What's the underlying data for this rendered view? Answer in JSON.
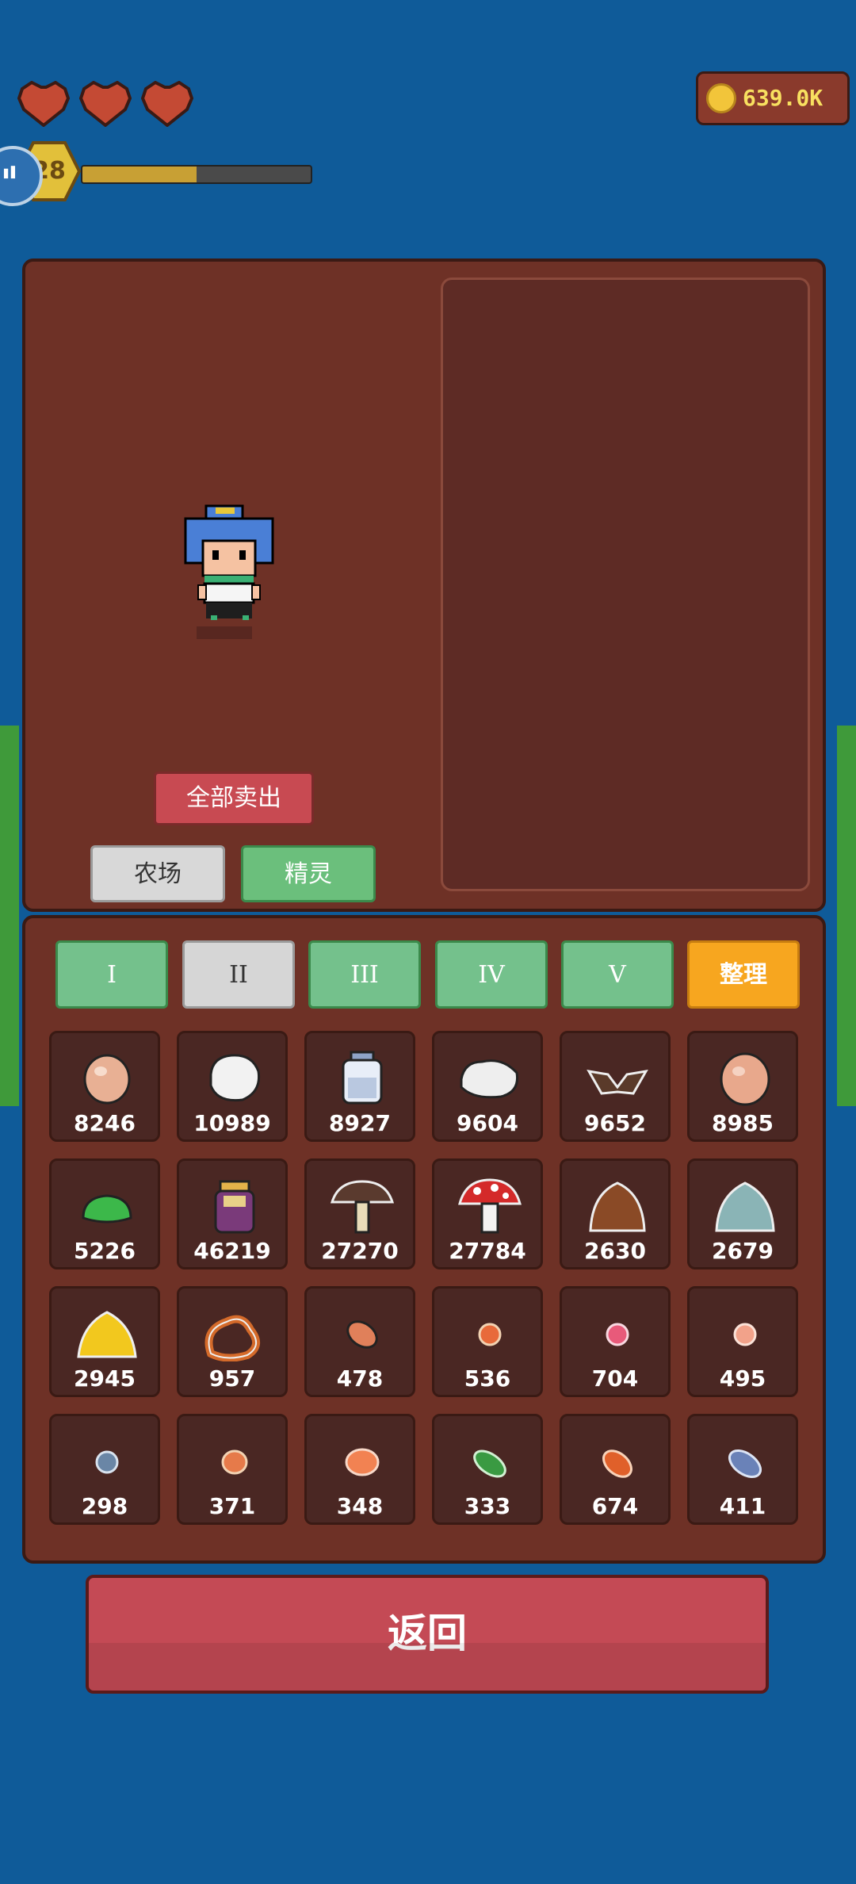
{
  "hud": {
    "hearts": 3,
    "level": "28",
    "level_progress": 0.5,
    "coins": "639.0K"
  },
  "buttons": {
    "sell_all": "全部卖出",
    "farm_tab": "农场",
    "elf_tab": "精灵",
    "back": "返回"
  },
  "tiers": [
    "I",
    "II",
    "III",
    "IV",
    "V"
  ],
  "sort_label": "整理",
  "items": [
    {
      "icon": "egg-icon",
      "qty": "8246"
    },
    {
      "icon": "wool-icon",
      "qty": "10989"
    },
    {
      "icon": "milk-bottle-icon",
      "qty": "8927"
    },
    {
      "icon": "cotton-icon",
      "qty": "9604"
    },
    {
      "icon": "bat-wing-icon",
      "qty": "9652"
    },
    {
      "icon": "egg-icon",
      "qty": "8985"
    },
    {
      "icon": "green-slime-icon",
      "qty": "5226"
    },
    {
      "icon": "potion-jar-icon",
      "qty": "46219"
    },
    {
      "icon": "brown-mushroom-icon",
      "qty": "27270"
    },
    {
      "icon": "red-mushroom-icon",
      "qty": "27784"
    },
    {
      "icon": "brown-slime-icon",
      "qty": "2630"
    },
    {
      "icon": "blue-slime-icon",
      "qty": "2679"
    },
    {
      "icon": "yellow-slime-icon",
      "qty": "2945"
    },
    {
      "icon": "pretzel-icon",
      "qty": "957"
    },
    {
      "icon": "meat-icon",
      "qty": "478"
    },
    {
      "icon": "orange-gem-icon",
      "qty": "536"
    },
    {
      "icon": "pink-gem-icon",
      "qty": "704"
    },
    {
      "icon": "peach-gem-icon",
      "qty": "495"
    },
    {
      "icon": "blue-gem-icon",
      "qty": "298"
    },
    {
      "icon": "orange-seed-icon",
      "qty": "371"
    },
    {
      "icon": "orange-bean-icon",
      "qty": "348"
    },
    {
      "icon": "green-pod-icon",
      "qty": "333"
    },
    {
      "icon": "orange-pod-icon",
      "qty": "674"
    },
    {
      "icon": "blue-pod-icon",
      "qty": "411"
    }
  ]
}
